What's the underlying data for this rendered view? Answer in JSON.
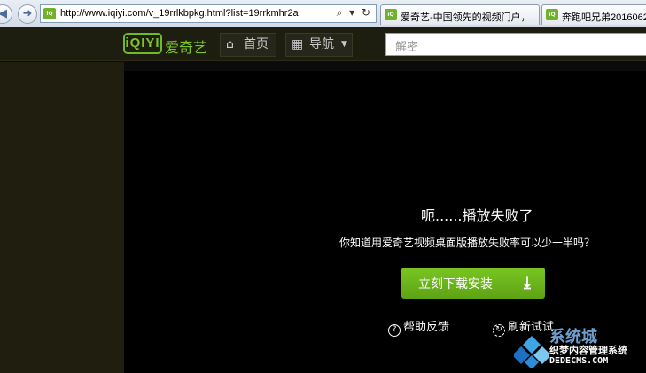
{
  "browser": {
    "address": {
      "url": "http://www.iqiyi.com/v_19rrlkbpkg.html?list=19rrkmhr2a",
      "favicon": "iqiyi-favicon"
    },
    "address_tools": "⌕ ▾ ↻",
    "tabs": [
      {
        "label": "爱奇艺-中国领先的视频门户，",
        "favicon": "iqiyi-favicon"
      },
      {
        "label": "奔跑吧兄弟2016062",
        "favicon": "iqiyi-favicon"
      }
    ]
  },
  "site": {
    "logo": "iQIYI",
    "brand_cn": "爱奇艺",
    "home_label": "首页",
    "nav_label": "导航",
    "search_placeholder": "解密",
    "brand_color": "#7cc42c"
  },
  "player": {
    "error_title": "呃......播放失败了",
    "error_subtitle": "你知道用爱奇艺视频桌面版播放失败率可以少一半吗？",
    "install_label": "立刻下载安装",
    "help_label": "帮助反馈",
    "refresh_label": "刷新试试",
    "button_color": "#6db51c"
  },
  "watermark": {
    "big": "系统城",
    "line1": "织梦内容管理系统",
    "line2": "DEDECMS.COM"
  }
}
